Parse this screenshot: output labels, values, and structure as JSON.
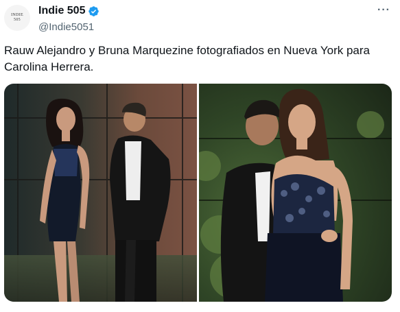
{
  "avatar": {
    "line1": "INDIE",
    "line2": "505"
  },
  "user": {
    "display_name": "Indie 505",
    "handle": "@Indie5051"
  },
  "more_menu": "···",
  "tweet": {
    "text_line1": "Rauw Alejandro y Bruna Marquezine fotografiados en Nueva York para",
    "text_line2": "Carolina Herrera."
  },
  "colors": {
    "verified_blue": "#1d9bf0",
    "text_primary": "#0f1419",
    "text_secondary": "#536471"
  },
  "icons": {
    "verified": "verified-badge-icon",
    "more": "more-dots-icon"
  }
}
